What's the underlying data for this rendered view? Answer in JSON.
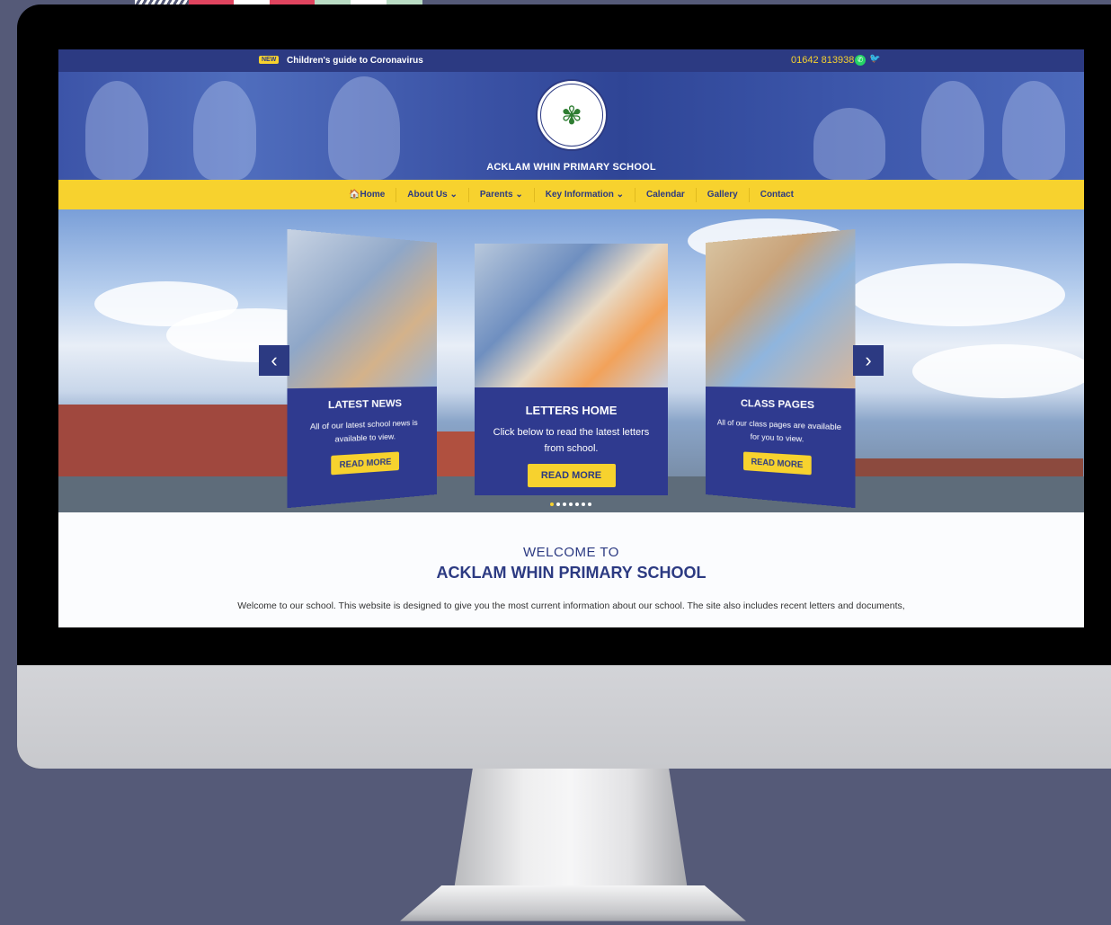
{
  "topbar": {
    "new_badge": "NEW",
    "notice": "Children's guide to Coronavirus",
    "phone": "01642 813938"
  },
  "header": {
    "school_name": "ACKLAM WHIN PRIMARY SCHOOL",
    "logo_text": "ACKLAM WHIN PRIMARY SCHOOL"
  },
  "nav": {
    "items": [
      {
        "label": "🏠Home"
      },
      {
        "label": "About Us ⌄"
      },
      {
        "label": "Parents ⌄"
      },
      {
        "label": "Key Information ⌄"
      },
      {
        "label": "Calendar"
      },
      {
        "label": "Gallery"
      },
      {
        "label": "Contact"
      }
    ]
  },
  "slider": {
    "cards": [
      {
        "title": "LATEST NEWS",
        "text": "All of our latest school news is available to view.",
        "button": "READ MORE"
      },
      {
        "title": "LETTERS HOME",
        "text": "Click below to read the latest letters from school.",
        "button": "READ MORE"
      },
      {
        "title": "CLASS PAGES",
        "text": "All of our class pages are available for you to view.",
        "button": "READ MORE"
      }
    ],
    "prev_icon": "chevron-left-icon",
    "next_icon": "chevron-right-icon",
    "dot_count": 7,
    "active_dot": 0
  },
  "welcome": {
    "heading_small": "WELCOME TO",
    "heading_large": "ACKLAM WHIN PRIMARY SCHOOL",
    "body": "Welcome to our school. This website is designed to give you the most current information about our school. The site also includes recent letters and documents,"
  },
  "colors": {
    "brand_blue": "#2c3a82",
    "brand_yellow": "#f7d22e",
    "desktop_bg": "#555a78"
  }
}
